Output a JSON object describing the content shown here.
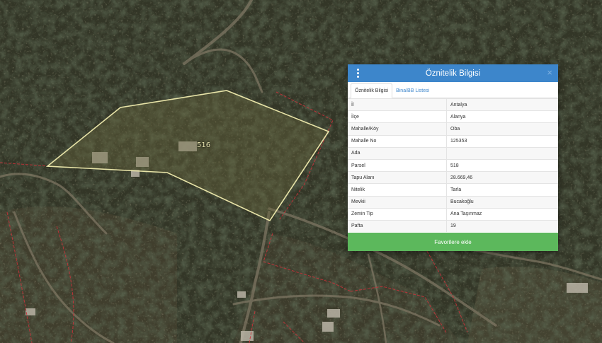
{
  "map": {
    "parcel_label": "516"
  },
  "panel": {
    "title": "Öznitelik Bilgisi",
    "close_symbol": "×",
    "tabs": [
      {
        "label": "Öznitelik Bilgisi",
        "active": true
      },
      {
        "label": "Bina/BB Listesi",
        "active": false
      }
    ],
    "rows": [
      {
        "key": "İl",
        "value": "Antalya"
      },
      {
        "key": "İlçe",
        "value": "Alanya"
      },
      {
        "key": "Mahalle/Köy",
        "value": "Oba"
      },
      {
        "key": "Mahalle No",
        "value": "125353"
      },
      {
        "key": "Ada",
        "value": ""
      },
      {
        "key": "Parsel",
        "value": "518"
      },
      {
        "key": "Tapu Alanı",
        "value": "28.669,46"
      },
      {
        "key": "Nitelik",
        "value": "Tarla"
      },
      {
        "key": "Mevkii",
        "value": "Bucakoğlu"
      },
      {
        "key": "Zemin Tip",
        "value": "Ana Taşınmaz"
      },
      {
        "key": "Pafta",
        "value": "19"
      }
    ],
    "favorite_button": "Favorilere ekle"
  },
  "colors": {
    "header_blue": "#3d86cb",
    "button_green": "#5cb85c",
    "parcel_outline": "#e8e4a8",
    "boundary_red": "#c8323a"
  },
  "icons": {
    "menu": "vertical-dots-icon",
    "close": "close-icon"
  }
}
